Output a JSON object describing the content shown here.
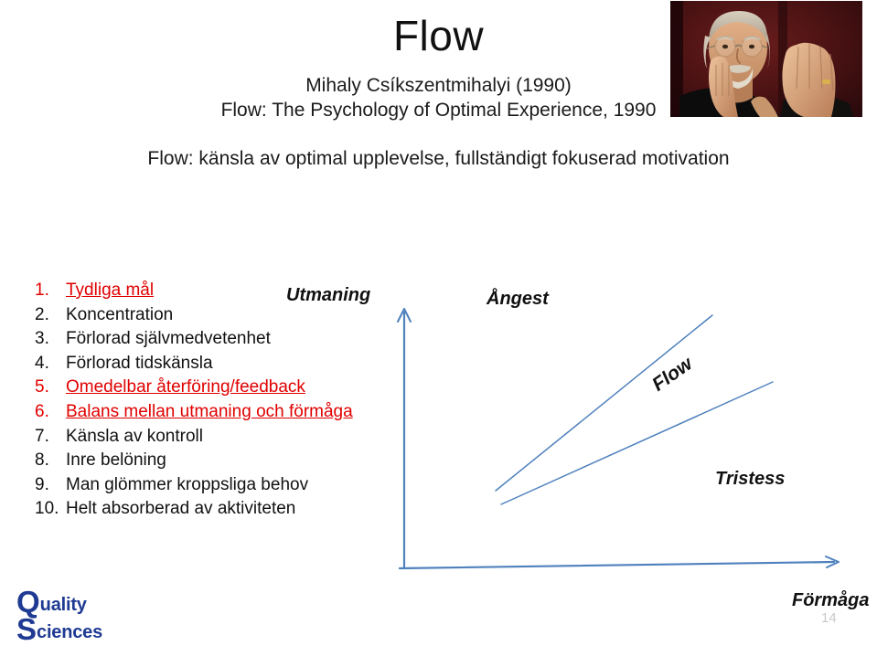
{
  "slide": {
    "title": "Flow",
    "author_line": "Mihaly Csíkszentmihalyi  (1990)",
    "book_line": "Flow: The Psychology of Optimal Experience, 1990",
    "tagline": "Flow: känsla av optimal upplevelse, fullständigt fokuserad motivation",
    "page_number": "14"
  },
  "portrait": {
    "alt": "portrait-photo-mihaly-csikszentmihalyi",
    "background_color": "#3a0f12"
  },
  "list": {
    "items": [
      {
        "num": "1.",
        "text": "Tydliga mål",
        "highlight": true
      },
      {
        "num": "2.",
        "text": "Koncentration",
        "highlight": false
      },
      {
        "num": "3.",
        "text": "Förlorad självmedvetenhet",
        "highlight": false
      },
      {
        "num": "4.",
        "text": "Förlorad tidskänsla",
        "highlight": false
      },
      {
        "num": "5.",
        "text": "Omedelbar återföring/feedback",
        "highlight": true
      },
      {
        "num": "6.",
        "text": "Balans mellan utmaning och förmåga",
        "highlight": true
      },
      {
        "num": "7.",
        "text": "Känsla av kontroll",
        "highlight": false
      },
      {
        "num": "8.",
        "text": "Inre belöning",
        "highlight": false
      },
      {
        "num": "9.",
        "text": "Man glömmer kroppsliga behov",
        "highlight": false
      },
      {
        "num": "10.",
        "text": "Helt absorberad av aktiviteten",
        "highlight": false
      }
    ],
    "highlight_color": "#e00000",
    "normal_color": "#111111"
  },
  "diagram": {
    "y_axis_label": "Utmaning",
    "x_axis_label": "Förmåga",
    "zone_high": "Ångest",
    "zone_channel": "Flow",
    "zone_low": "Tristess",
    "line_color": "#4f81bd"
  },
  "logo": {
    "letter_q": "Q",
    "word_quality": "uality",
    "letter_s": "S",
    "word_sciences": "ciences",
    "color": "#1f3a93"
  },
  "chart_data": {
    "type": "line",
    "title": "Flow channel model",
    "xlabel": "Förmåga",
    "ylabel": "Utmaning",
    "grid": false,
    "legend_position": "none",
    "annotations": [
      "Ångest",
      "Flow",
      "Tristess"
    ],
    "series": [
      {
        "name": "upper-boundary",
        "x": [
          0.22,
          0.7
        ],
        "y": [
          0.3,
          0.98
        ]
      },
      {
        "name": "lower-boundary",
        "x": [
          0.23,
          0.85
        ],
        "y": [
          0.25,
          0.72
        ]
      }
    ]
  }
}
